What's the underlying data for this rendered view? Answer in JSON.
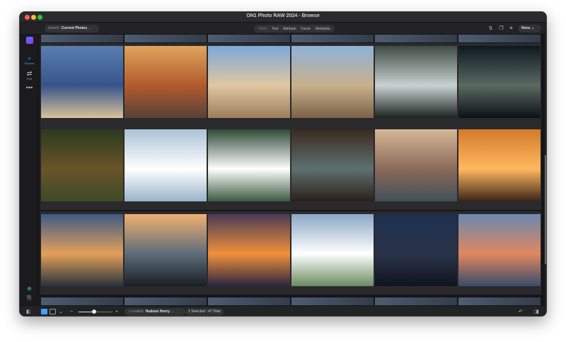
{
  "window": {
    "title": "ON1 Photo RAW 2024 - Browse"
  },
  "toolbar": {
    "search_label": "Search",
    "search_scope": "Current Photos",
    "filter_tabs": [
      "None",
      "Text",
      "Attribute",
      "Faces",
      "Metadata"
    ],
    "active_filter": "None",
    "preset_dropdown": "None"
  },
  "sidebar": {
    "items": [
      {
        "label": "Browse",
        "icon": "browse-icon",
        "active": true
      },
      {
        "label": "Edit",
        "icon": "edit-icon",
        "active": false
      }
    ]
  },
  "grid": {
    "columns": 6,
    "rows": [
      [
        {
          "colors": [
            "#5a7eb0",
            "#37548a",
            "#d8c29a"
          ],
          "desc": ""
        },
        {
          "colors": [
            "#e0a45c",
            "#b25a2e",
            "#574238"
          ]
        },
        {
          "colors": [
            "#7ba9da",
            "#e0c7a0",
            "#9c7e5c"
          ]
        },
        {
          "colors": [
            "#8eb2d8",
            "#c9b08a",
            "#7a6148"
          ]
        },
        {
          "colors": [
            "#3f4b45",
            "#c8d2d0",
            "#1c2320"
          ]
        },
        {
          "colors": [
            "#0e1820",
            "#5a6a60",
            "#0b1115"
          ]
        }
      ],
      [
        {
          "colors": [
            "#2a3a1e",
            "#6a5428",
            "#3c4a28"
          ]
        },
        {
          "colors": [
            "#aac3d6",
            "#ffffff",
            "#98b4c8"
          ]
        },
        {
          "colors": [
            "#2e4b36",
            "#ffffff",
            "#3a5a40"
          ]
        },
        {
          "colors": [
            "#3b2a1f",
            "#5e7070",
            "#2a2018"
          ]
        },
        {
          "colors": [
            "#d6b898",
            "#8a6a58",
            "#40505a"
          ]
        },
        {
          "colors": [
            "#d27a2a",
            "#ffb860",
            "#3a2418"
          ]
        }
      ],
      [
        {
          "colors": [
            "#3e5a84",
            "#e3a05a",
            "#28323c"
          ]
        },
        {
          "colors": [
            "#f0b070",
            "#5e6c7a",
            "#1a1e22"
          ]
        },
        {
          "colors": [
            "#4a3a58",
            "#f0903a",
            "#2a2440"
          ]
        },
        {
          "colors": [
            "#8aa6c4",
            "#ffffff",
            "#6a8a60"
          ]
        },
        {
          "colors": [
            "#1e3050",
            "#2a3448",
            "#0e1420"
          ]
        },
        {
          "colors": [
            "#6a88b0",
            "#e08860",
            "#3a4a6a"
          ]
        }
      ]
    ]
  },
  "statusbar": {
    "zoom_fraction": 0.45,
    "location_label": "Location",
    "location_value": "Hudson Henry",
    "selection_text": "1 Selected - 47 Total"
  }
}
